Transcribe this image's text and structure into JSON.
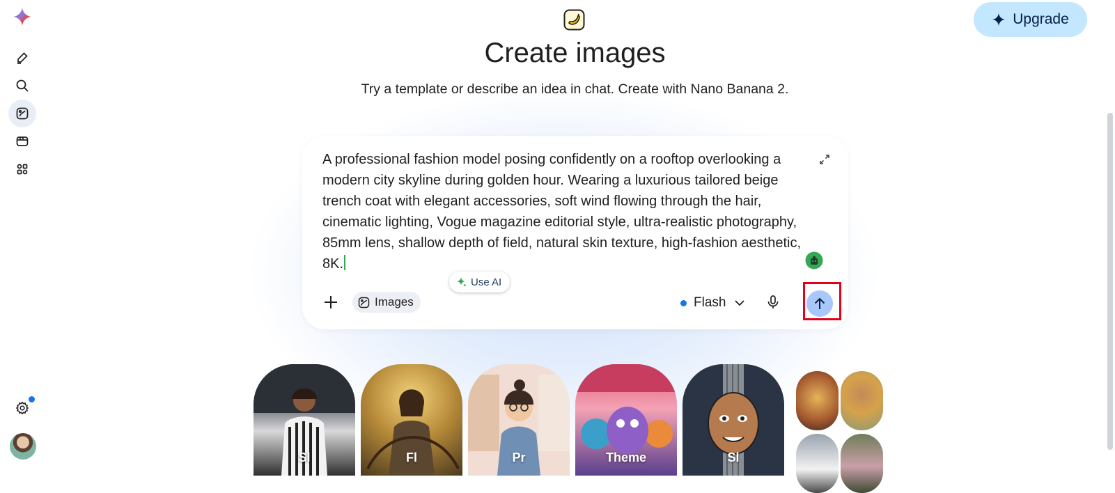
{
  "header": {
    "title": "Create images",
    "subtitle": "Try a template or describe an idea in chat. Create with Nano Banana 2.",
    "upgrade_label": "Upgrade"
  },
  "sidebar": {
    "items": [
      {
        "name": "new-chat",
        "icon": "edit-icon"
      },
      {
        "name": "search",
        "icon": "search-icon"
      },
      {
        "name": "create-images",
        "icon": "image-create-icon",
        "active": true
      },
      {
        "name": "videos",
        "icon": "video-icon"
      },
      {
        "name": "apps",
        "icon": "apps-icon"
      }
    ],
    "settings_icon": "gear-icon",
    "has_notification": true
  },
  "composer": {
    "prompt": "A professional fashion model posing confidently on a rooftop overlooking a modern city skyline during golden hour. Wearing a luxurious tailored beige trench coat with elegant accessories, soft wind flowing through the hair, cinematic lighting, Vogue magazine editorial style, ultra-realistic photography, 85mm lens, shallow depth of field, natural skin texture, high-fashion aesthetic, 8K.",
    "use_ai_label": "Use AI",
    "tool_chip_label": "Images",
    "model_label": "Flash"
  },
  "templates": {
    "cards": [
      {
        "label": "Sl",
        "theme": "sports"
      },
      {
        "label": "Fl",
        "theme": "fantasy"
      },
      {
        "label": "Pr",
        "theme": "illustration"
      },
      {
        "label": "Theme",
        "theme": "party"
      },
      {
        "label": "Sl",
        "theme": "cartoon"
      }
    ]
  },
  "colors": {
    "accent": "#1a73e8",
    "upgrade_bg": "#c2e7ff",
    "send_bg": "#a8c7fa",
    "highlight": "#e3001b"
  }
}
